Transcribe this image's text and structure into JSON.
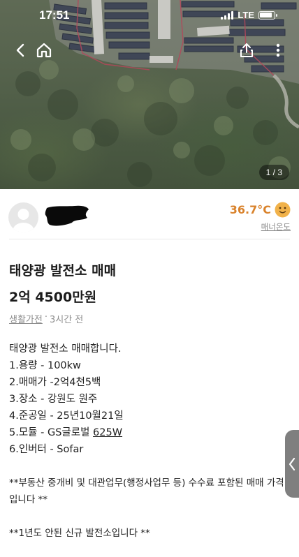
{
  "status_bar": {
    "time": "17:51",
    "network": "LTE"
  },
  "photo": {
    "counter": "1 / 3"
  },
  "icons": {
    "back": "chevron-left-icon",
    "home": "home-icon",
    "share": "share-icon",
    "more": "more-vertical-icon",
    "handle": "chevron-left-icon"
  },
  "seller": {
    "manner_temperature": "36.7°C",
    "manner_label": "매너온도",
    "temperature_color": "#d9822b"
  },
  "post": {
    "title": "태양광 발전소 매매",
    "price": "2억 4500만원",
    "category": "생활가전",
    "separator": "·",
    "posted_ago": "3시간 전",
    "description_lines": [
      "태양광 발전소 매매합니다.",
      "1.용량 - 100kw",
      "2.매매가 -2억4천5백",
      "3.장소 - 강원도 원주",
      "4.준공일 - 25년10월21일"
    ],
    "module_prefix": "5.모듈 - GS글로벌 ",
    "module_wattage": "625W",
    "inverter_line": "6.인버터 - Sofar",
    "note_fee": "**부동산 중개비 및 대관업무(행정사업무 등) 수수료 포함된 매매 가격입니다 **",
    "note_new": "**1년도 안된 신규 발전소입니다 **"
  }
}
